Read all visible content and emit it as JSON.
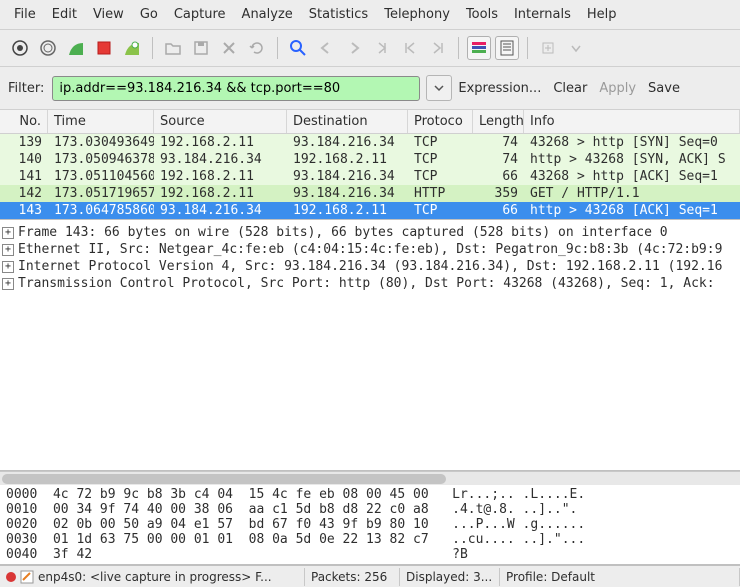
{
  "menu": [
    "File",
    "Edit",
    "View",
    "Go",
    "Capture",
    "Analyze",
    "Statistics",
    "Telephony",
    "Tools",
    "Internals",
    "Help"
  ],
  "filter": {
    "label": "Filter:",
    "value": "ip.addr==93.184.216.34 && tcp.port==80",
    "expression": "Expression...",
    "clear": "Clear",
    "apply": "Apply",
    "save": "Save"
  },
  "columns": {
    "no": "No.",
    "time": "Time",
    "src": "Source",
    "dst": "Destination",
    "proto": "Protoco",
    "len": "Length",
    "info": "Info"
  },
  "packets": [
    {
      "no": "139",
      "time": "173.030493649",
      "src": "192.168.2.11",
      "dst": "93.184.216.34",
      "proto": "TCP",
      "len": "74",
      "info": "43268 > http [SYN] Seq=0",
      "cls": "green-lt"
    },
    {
      "no": "140",
      "time": "173.050946378",
      "src": "93.184.216.34",
      "dst": "192.168.2.11",
      "proto": "TCP",
      "len": "74",
      "info": "http > 43268 [SYN, ACK] S",
      "cls": "green-lt"
    },
    {
      "no": "141",
      "time": "173.051104560",
      "src": "192.168.2.11",
      "dst": "93.184.216.34",
      "proto": "TCP",
      "len": "66",
      "info": "43268 > http [ACK] Seq=1",
      "cls": "green-lt"
    },
    {
      "no": "142",
      "time": "173.051719657",
      "src": "192.168.2.11",
      "dst": "93.184.216.34",
      "proto": "HTTP",
      "len": "359",
      "info": "GET / HTTP/1.1",
      "cls": "green-md"
    },
    {
      "no": "143",
      "time": "173.064785860",
      "src": "93.184.216.34",
      "dst": "192.168.2.11",
      "proto": "TCP",
      "len": "66",
      "info": "http > 43268 [ACK] Seq=1",
      "cls": "sel"
    }
  ],
  "tree": [
    "Frame 143: 66 bytes on wire (528 bits), 66 bytes captured (528 bits) on interface 0",
    "Ethernet II, Src: Netgear_4c:fe:eb (c4:04:15:4c:fe:eb), Dst: Pegatron_9c:b8:3b (4c:72:b9:9",
    "Internet Protocol Version 4, Src: 93.184.216.34 (93.184.216.34), Dst: 192.168.2.11 (192.16",
    "Transmission Control Protocol, Src Port: http (80), Dst Port: 43268 (43268), Seq: 1, Ack:"
  ],
  "hex": [
    {
      "off": "0000",
      "b": "4c 72 b9 9c b8 3b c4 04  15 4c fe eb 08 00 45 00",
      "a": "Lr...;.. .L....E."
    },
    {
      "off": "0010",
      "b": "00 34 9f 74 40 00 38 06  aa c1 5d b8 d8 22 c0 a8",
      "a": ".4.t@.8. ..]..\"."
    },
    {
      "off": "0020",
      "b": "02 0b 00 50 a9 04 e1 57  bd 67 f0 43 9f b9 80 10",
      "a": "...P...W .g......"
    },
    {
      "off": "0030",
      "b": "01 1d 63 75 00 00 01 01  08 0a 5d 0e 22 13 82 c7",
      "a": "..cu.... ..].\"..."
    },
    {
      "off": "0040",
      "b": "3f 42",
      "a": "?B"
    }
  ],
  "status": {
    "iface": "enp4s0: <live capture in progress> F...",
    "packets": "Packets: 256",
    "displayed": "Displayed: 3...",
    "profile": "Profile: Default"
  }
}
